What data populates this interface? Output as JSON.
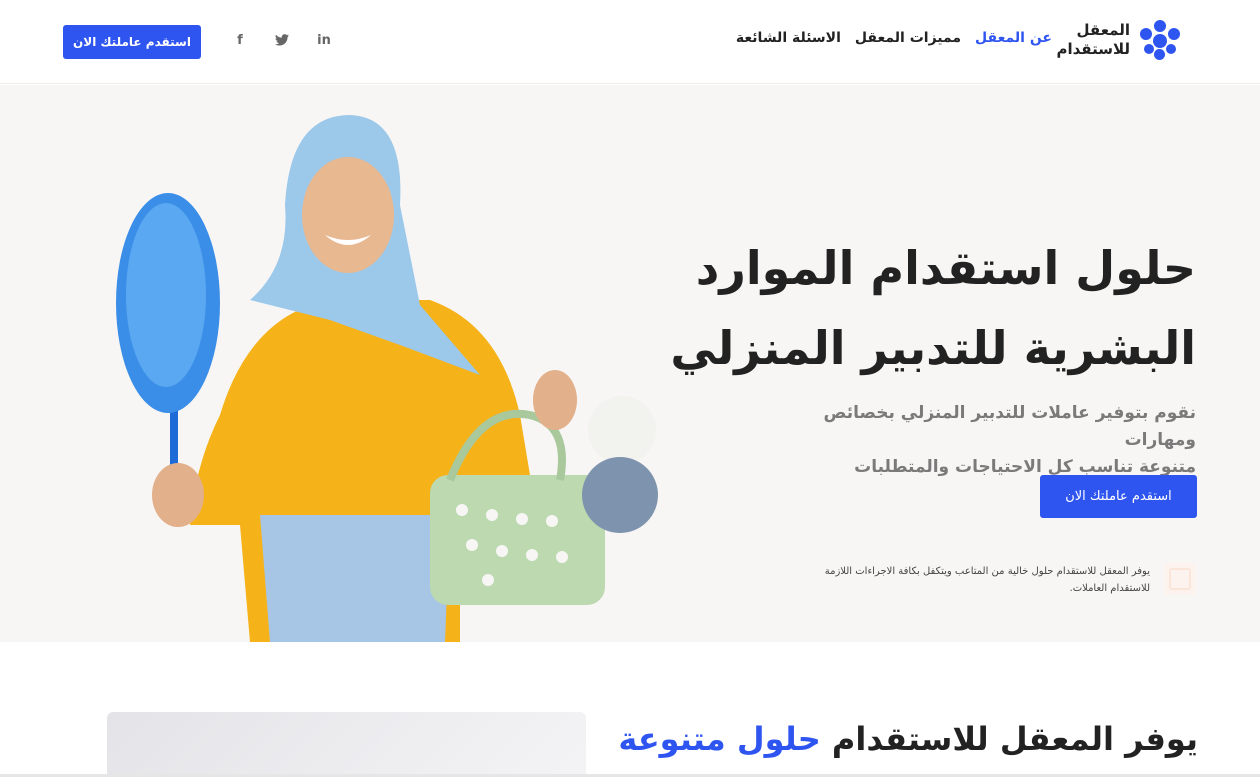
{
  "header": {
    "logo_line1": "المعقل",
    "logo_line2": "للاستقدام",
    "nav": [
      {
        "label": "عن المعقل",
        "active": true
      },
      {
        "label": "مميزات المعقل",
        "active": false
      },
      {
        "label": "الاسئلة الشائعة",
        "active": false
      }
    ],
    "social": [
      "linkedin-icon",
      "twitter-icon",
      "facebook-icon"
    ],
    "social_glyphs": {
      "linkedin": "in",
      "twitter": "🐦",
      "facebook": "f"
    },
    "cta_label": "استقدم عاملتك الان"
  },
  "hero": {
    "title_line1": "حلول استقدام الموارد",
    "title_line2": "البشرية للتدبير المنزلي",
    "subtitle_line1": "نقوم بتوفير عاملات للتدبير المنزلي بخصائص ومهارات",
    "subtitle_line2": "متنوعة تناسب كل الاحتياجات والمتطلبات",
    "cta_label": "استقدم عاملتك الان",
    "note_line1": "يوفر المعقل للاستقدام حلول خالية من المتاعب ويتكفل بكافة الاجراءات اللازمة",
    "note_line2": "للاستقدام العاملات."
  },
  "section2": {
    "title_part1": "يوفر المعقل للاستقدام ",
    "title_highlight": "حلول متنوعة"
  },
  "colors": {
    "accent": "#2f55f0",
    "hero_bg": "#f8f6f5",
    "text_dark": "#222222",
    "text_muted": "#7a7a7a"
  }
}
